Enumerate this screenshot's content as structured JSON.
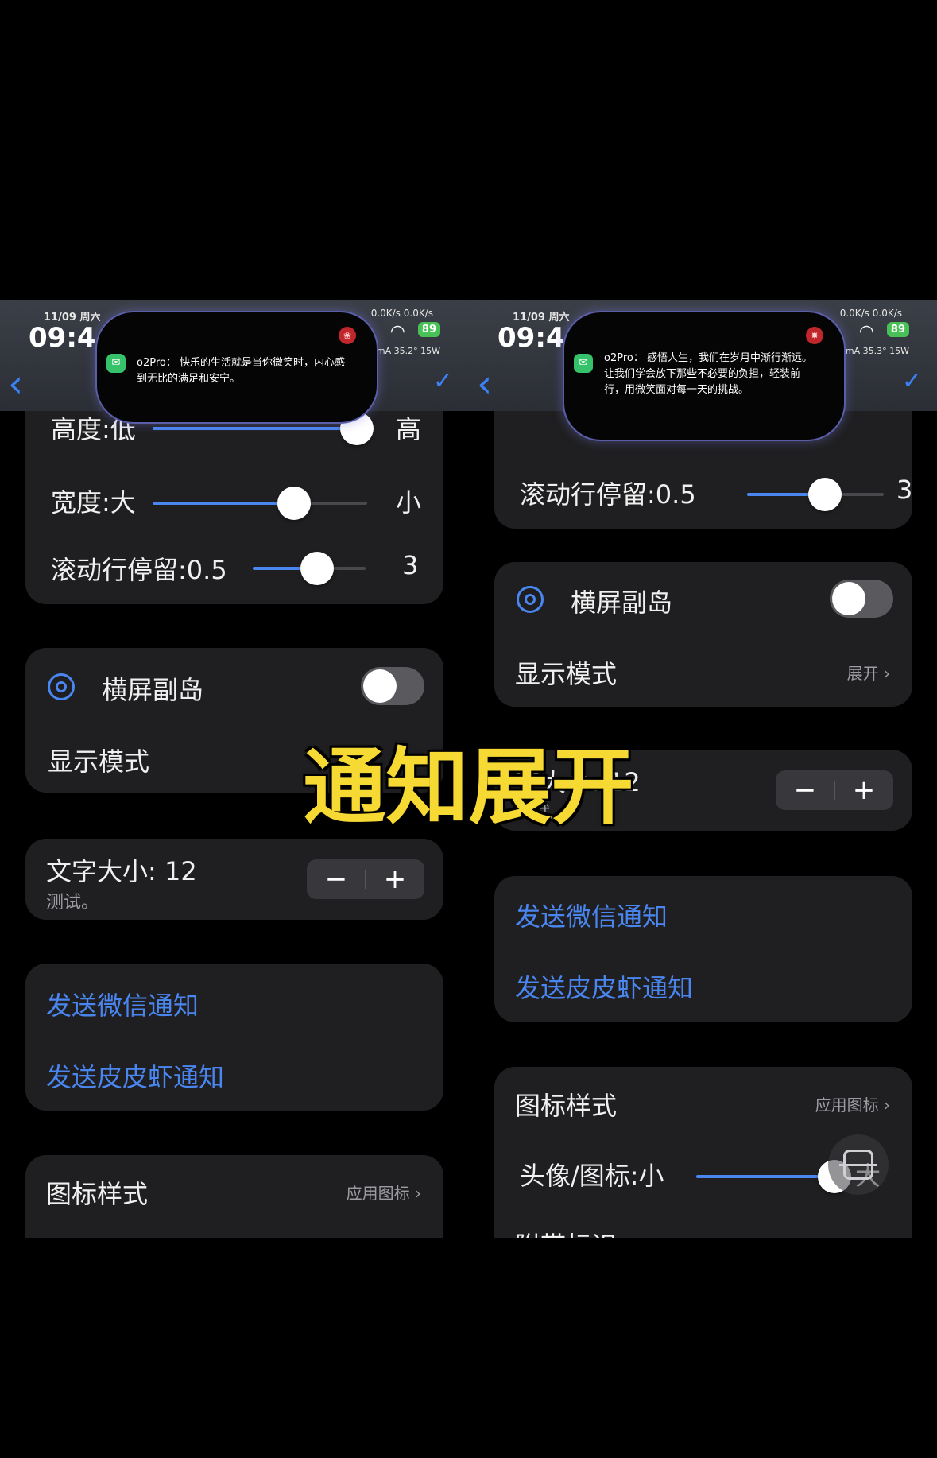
{
  "overlay_title": "通知展开",
  "left": {
    "status": {
      "date": "11/09",
      "weekday": "周六",
      "time": "09:4",
      "speed": "0.0K/s 0.0K/s",
      "battery": "89",
      "power": "mA 35.2° 15W"
    },
    "island_text": "o2Pro： 快乐的生活就是当你微笑时，内心感到无比的满足和安宁。",
    "slider_card": {
      "height_label": "高度:低",
      "height_right": "高",
      "height_value": 0.95,
      "width_label": "宽度:大",
      "width_right": "小",
      "width_value": 0.66,
      "scroll_label": "滚动行停留:0.5",
      "scroll_right": "3",
      "scroll_value": 0.57
    },
    "landscape": {
      "label": "横屏副岛",
      "mode_label": "显示模式"
    },
    "font": {
      "label": "文字大小: 12",
      "sub": "测试。",
      "minus": "−",
      "plus": "+"
    },
    "links": {
      "wechat": "发送微信通知",
      "pipixia": "发送皮皮虾通知"
    },
    "icon_style": {
      "label": "图标样式",
      "value": "应用图标 ›"
    }
  },
  "right": {
    "status": {
      "date": "11/09",
      "weekday": "周六",
      "time": "09:4",
      "speed": "0.0K/s 0.0K/s",
      "battery": "89",
      "power": "mA 35.3° 15W"
    },
    "island_text": "o2Pro： 感悟人生，我们在岁月中渐行渐远。让我们学会放下那些不必要的负担，轻装前行，用微笑面对每一天的挑战。",
    "slider_card": {
      "scroll_label": "滚动行停留:0.5",
      "scroll_right": "3",
      "scroll_value": 0.57
    },
    "landscape": {
      "label": "横屏副岛",
      "mode_label": "显示模式",
      "mode_value": "展开 ›"
    },
    "font": {
      "label": "字大小: 12",
      "sub": "测试。",
      "minus": "−",
      "plus": "+"
    },
    "links": {
      "wechat": "发送微信通知",
      "pipixia": "发送皮皮虾通知"
    },
    "icon_style": {
      "label": "图标样式",
      "value": "应用图标 ›",
      "avatar_label": "头像/图标:小",
      "avatar_right": "大",
      "avatar_value": 0.98,
      "tail_label": "附带标识"
    }
  },
  "colors": {
    "accent": "#4a86f0",
    "overlay": "#f6d932",
    "card": "#1f1f21"
  }
}
